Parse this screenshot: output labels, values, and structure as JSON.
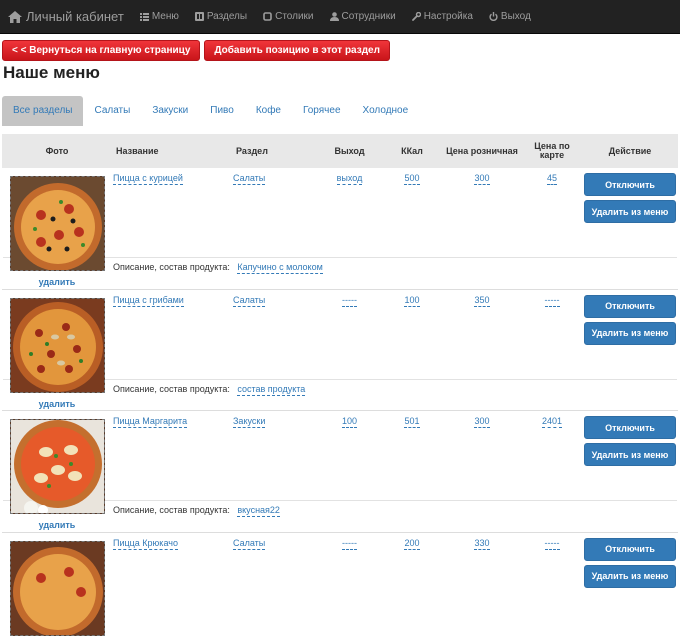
{
  "nav": {
    "brand": "Личный кабинет",
    "items": [
      {
        "label": "Меню",
        "icon": "list-icon"
      },
      {
        "label": "Разделы",
        "icon": "book-icon"
      },
      {
        "label": "Столики",
        "icon": "square-icon"
      },
      {
        "label": "Сотрудники",
        "icon": "user-icon"
      },
      {
        "label": "Настройка",
        "icon": "wrench-icon"
      },
      {
        "label": "Выход",
        "icon": "power-icon"
      }
    ]
  },
  "actions": {
    "back": "< < Вернуться на главную страницу",
    "add": "Добавить позицию в этот раздел"
  },
  "page_title": "Наше меню",
  "tabs": [
    "Все разделы",
    "Салаты",
    "Закуски",
    "Пиво",
    "Кофе",
    "Горячее",
    "Холодное"
  ],
  "table": {
    "headers": {
      "photo": "Фото",
      "name": "Название",
      "section": "Раздел",
      "output": "Выход",
      "kcal": "ККал",
      "price_retail": "Цена розничная",
      "price_card": "Цена по карте",
      "action": "Действие"
    },
    "delete_photo": "удалить",
    "desc_label": "Описание, состав продукта:",
    "btn_disable": "Отключить",
    "btn_remove": "Удалить из меню",
    "rows": [
      {
        "name": "Пицца с курицей",
        "section": "Салаты",
        "output": "выход",
        "kcal": "500",
        "price": "300",
        "card": "45",
        "desc": "Капучино с молоком"
      },
      {
        "name": "Пицца с грибами",
        "section": "Салаты",
        "output": "-----",
        "kcal": "100",
        "price": "350",
        "card": "-----",
        "desc": "состав продукта"
      },
      {
        "name": "Пицца Маргарита",
        "section": "Закуски",
        "output": "100",
        "kcal": "501",
        "price": "300",
        "card": "2401",
        "desc": "вкусная22"
      },
      {
        "name": "Пицца Крюкачо",
        "section": "Салаты",
        "output": "-----",
        "kcal": "200",
        "price": "330",
        "card": "-----",
        "desc": ""
      }
    ]
  },
  "colors": {
    "navbar": "#222222",
    "red_button": "#d9181e",
    "blue_button": "#337ab7",
    "link": "#337ab7",
    "active_tab": "#c4c4c4"
  }
}
